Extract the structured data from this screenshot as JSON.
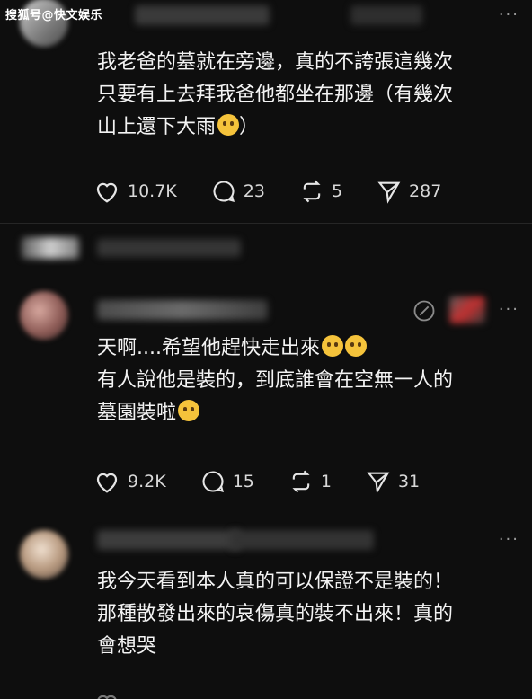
{
  "watermark": "搜狐号@快文娱乐",
  "comments": [
    {
      "lines": [
        "我老爸的墓就在旁邊，真的不誇張這幾次",
        "只要有上去拜我爸他都坐在那邊（有幾次",
        "山上還下大雨"
      ],
      "line3_suffix": "）",
      "likes": "10.7K",
      "replies": "23",
      "reposts": "5",
      "shares": "287"
    },
    {
      "lines": [
        "天啊....希望他趕快走出來",
        "有人說他是裝的，到底誰會在空無一人的",
        "墓園裝啦"
      ],
      "likes": "9.2K",
      "replies": "15",
      "reposts": "1",
      "shares": "31",
      "more": "···"
    },
    {
      "lines": [
        "我今天看到本人真的可以保證不是裝的！",
        "那種散發出來的哀傷真的裝不出來！真的",
        "會想哭"
      ],
      "more": "···"
    }
  ],
  "icons": [
    "heart-icon",
    "reply-icon",
    "repost-icon",
    "share-icon",
    "edit-icon",
    "more-icon",
    "emoji-icon"
  ]
}
